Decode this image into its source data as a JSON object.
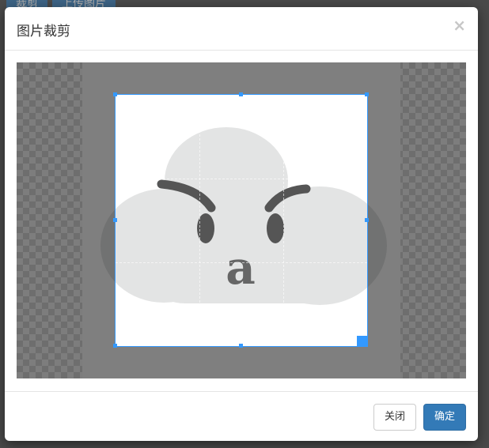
{
  "background_tabs": [
    {
      "label": "裁剪"
    },
    {
      "label": "上传图片"
    }
  ],
  "modal": {
    "title": "图片裁剪",
    "close_label": "×",
    "footer": {
      "close_button": "关闭",
      "confirm_button": "确定"
    }
  },
  "image": {
    "letter": "a"
  },
  "colors": {
    "primary": "#337ab7",
    "crop_border": "#3399ff",
    "backdrop": "#4a4a4a"
  },
  "icons": {
    "close": "close-icon",
    "crop_handle": "resize-handle-icon"
  }
}
